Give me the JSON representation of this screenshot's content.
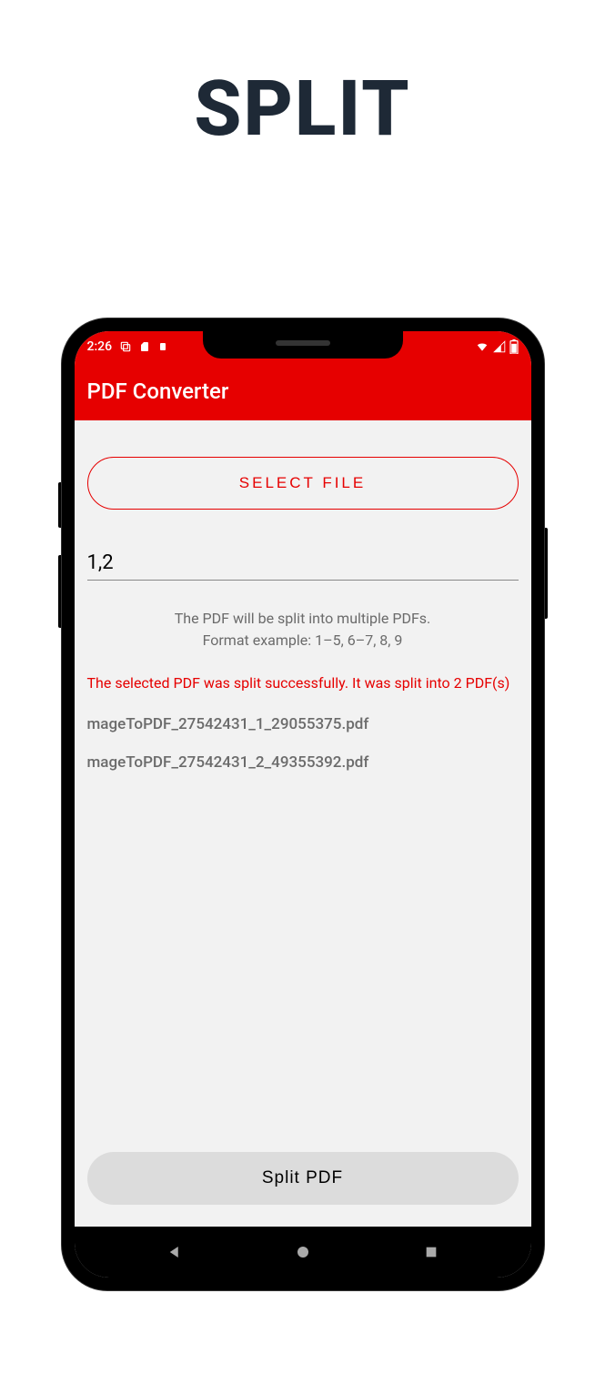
{
  "promo_title": "SPLIT",
  "status_bar": {
    "time": "2:26"
  },
  "app_header": {
    "title": "PDF Converter"
  },
  "content": {
    "select_file_label": "SELECT FILE",
    "page_input_value": "1,2",
    "hint_line1": "The PDF will be split into multiple PDFs.",
    "hint_line2": "Format example: 1–5, 6–7, 8, 9",
    "success_message": "The selected PDF was split successfully. It was split into 2 PDF(s)",
    "output_files": [
      "mageToPDF_27542431_1_29055375.pdf",
      "mageToPDF_27542431_2_49355392.pdf"
    ],
    "split_button_label": "Split PDF"
  }
}
